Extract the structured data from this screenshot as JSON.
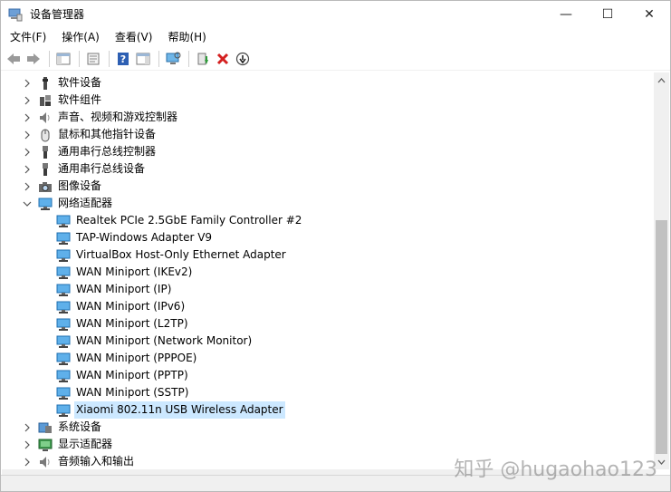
{
  "window": {
    "title": "设备管理器",
    "controls": {
      "minimize": "—",
      "maximize": "☐",
      "close": "✕"
    }
  },
  "menu": [
    {
      "label": "文件(F)"
    },
    {
      "label": "操作(A)"
    },
    {
      "label": "查看(V)"
    },
    {
      "label": "帮助(H)"
    }
  ],
  "toolbar": {
    "buttons": [
      "back-icon",
      "forward-icon",
      "console-tree-icon",
      "properties-icon",
      "help-icon",
      "action-pane-icon",
      "scan-hardware-icon",
      "update-driver-icon",
      "uninstall-icon",
      "disable-device-icon"
    ]
  },
  "tree": {
    "categories_before": [
      {
        "label": "软件设备",
        "icon": "software-device-icon"
      },
      {
        "label": "软件组件",
        "icon": "software-component-icon"
      },
      {
        "label": "声音、视频和游戏控制器",
        "icon": "speaker-icon"
      },
      {
        "label": "鼠标和其他指针设备",
        "icon": "mouse-icon"
      },
      {
        "label": "通用串行总线控制器",
        "icon": "usb-icon"
      },
      {
        "label": "通用串行总线设备",
        "icon": "usb-icon"
      },
      {
        "label": "图像设备",
        "icon": "camera-icon"
      }
    ],
    "expanded_category": {
      "label": "网络适配器",
      "icon": "network-adapter-icon"
    },
    "adapters": [
      "Realtek PCIe 2.5GbE Family Controller #2",
      "TAP-Windows Adapter V9",
      "VirtualBox Host-Only Ethernet Adapter",
      "WAN Miniport (IKEv2)",
      "WAN Miniport (IP)",
      "WAN Miniport (IPv6)",
      "WAN Miniport (L2TP)",
      "WAN Miniport (Network Monitor)",
      "WAN Miniport (PPPOE)",
      "WAN Miniport (PPTP)",
      "WAN Miniport (SSTP)",
      "Xiaomi 802.11n USB Wireless Adapter"
    ],
    "selected_adapter": "Xiaomi 802.11n USB Wireless Adapter",
    "categories_after": [
      {
        "label": "系统设备",
        "icon": "system-device-icon"
      },
      {
        "label": "显示适配器",
        "icon": "display-adapter-icon"
      },
      {
        "label": "音频输入和输出",
        "icon": "speaker-icon"
      }
    ]
  },
  "watermark": "知乎 @hugaohao123",
  "colors": {
    "selection": "#cce8ff",
    "network_icon": "#2a8ad4",
    "scrollbar_thumb": "#c1c1c1"
  }
}
